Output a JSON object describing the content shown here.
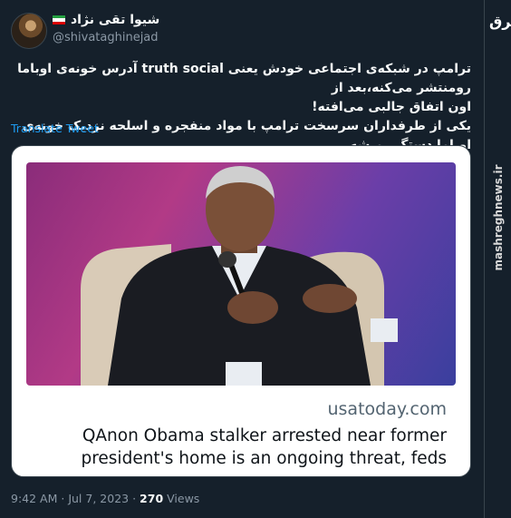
{
  "user": {
    "display_name": "شیوا تقی نژاد",
    "handle": "@shivataghinejad"
  },
  "tweet": {
    "lines": [
      "ترامپ در شبکه‌ی اجتماعی خودش یعنی truth social آدرس خونه‌ی اوباما رومنتشر می‌کنه،بعد از",
      "اون اتفاق جالبی می‌افته!",
      "یکی از طرفداران سرسخت ترامپ با مواد منفجره و اسلحه نزدیک خونه‌ی اوباما دستگیر میشه."
    ],
    "translate_label": "Translate Tweet"
  },
  "card": {
    "domain": "usatoday.com",
    "headline_line1": "QAnon Obama stalker arrested near former",
    "headline_line2": "president's home is an ongoing threat, feds say."
  },
  "meta": {
    "time": "9:42 AM",
    "date": "Jul 7, 2023",
    "views_count": "270",
    "views_label": "Views"
  },
  "watermark": {
    "logo": "مشرق",
    "site": "mashreghnews.ir"
  },
  "colors": {
    "background": "#15202b",
    "link": "#1d9bf0",
    "muted": "#8b98a5"
  }
}
